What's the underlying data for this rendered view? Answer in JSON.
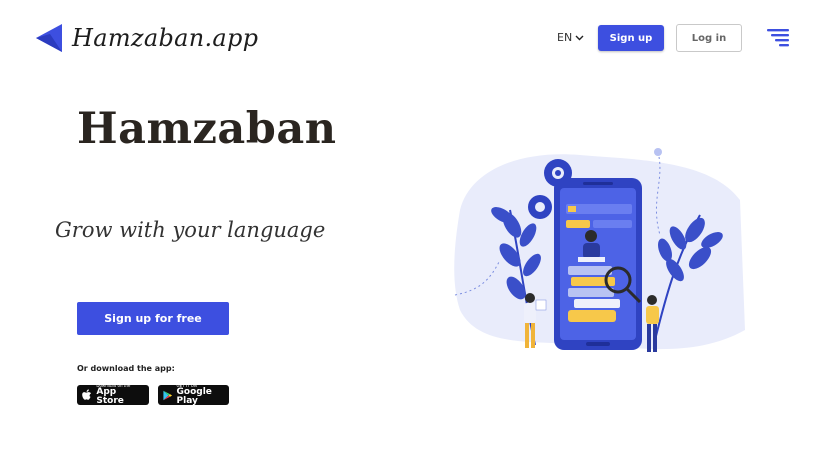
{
  "header": {
    "brand": "Hamzaban.app",
    "language": "EN",
    "signup_label": "Sign up",
    "login_label": "Log in"
  },
  "hero": {
    "title": "Hamzaban",
    "tagline": "Grow with your language",
    "cta_label": "Sign up for free",
    "download_label": "Or download the app:"
  },
  "stores": {
    "appstore": {
      "small": "Download on the",
      "big": "App Store"
    },
    "googleplay": {
      "small": "GET IT ON",
      "big": "Google Play"
    }
  },
  "colors": {
    "accent": "#3d4fe0",
    "blob": "#e9ecfb",
    "leaf": "#3a4fc9",
    "gear": "#2f43c2"
  },
  "icons": [
    "logo-mark-icon",
    "chevron-down-icon",
    "menu-icon",
    "apple-icon",
    "google-play-icon"
  ]
}
